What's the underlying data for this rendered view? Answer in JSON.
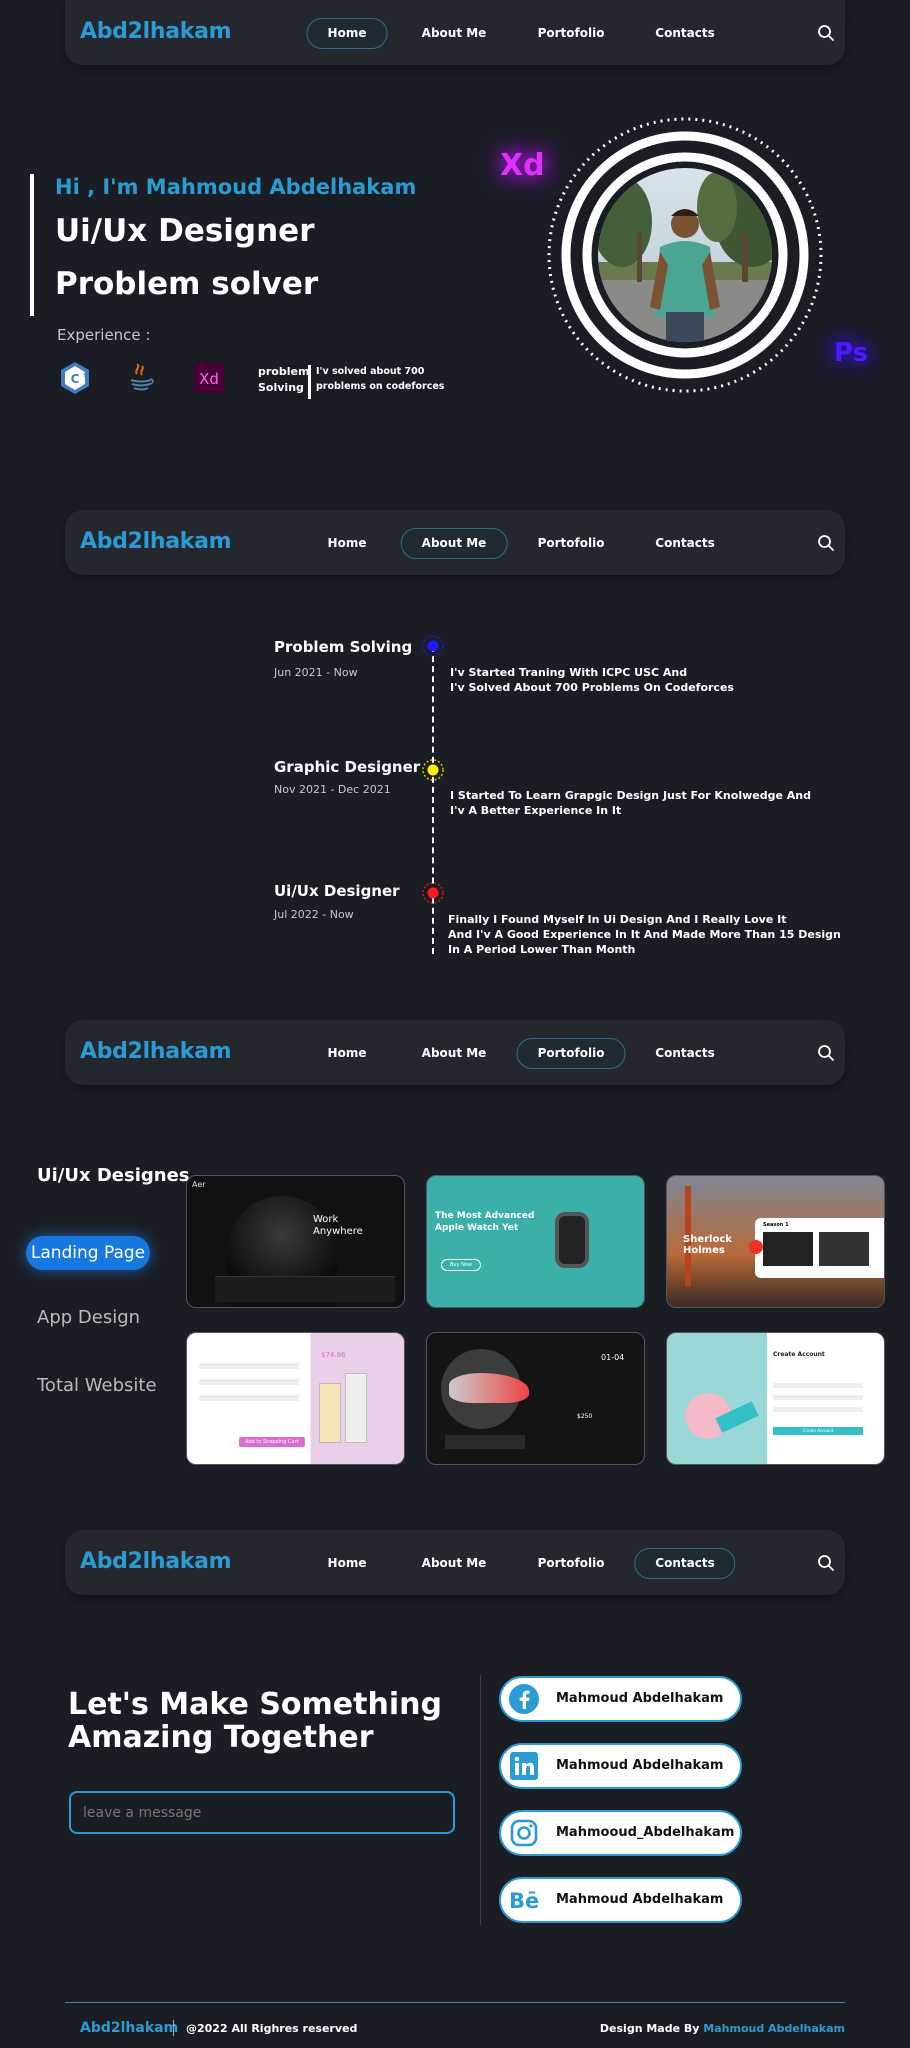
{
  "brand": "Abd2lhakam",
  "nav_items": [
    "Home",
    "About Me",
    "Portofolio",
    "Contacts"
  ],
  "navbars": [
    {
      "active": "Home"
    },
    {
      "active": "About Me"
    },
    {
      "active": "Portofolio"
    },
    {
      "active": "Contacts"
    }
  ],
  "hero": {
    "greeting": "Hi , I'm Mahmoud Abdelhakam",
    "role1": "Ui/Ux Designer",
    "role2": "Problem solver",
    "experience_label": "Experience :",
    "skills": [
      "c++-icon",
      "java-icon",
      "adobe-xd-icon"
    ],
    "xd_badge": "Xd",
    "problem_label_1": "problem",
    "problem_label_2": "Solving",
    "problem_note_1": "I'v solved about 700",
    "problem_note_2": "problems on codeforces",
    "glow_xd": "Xd",
    "glow_ps": "Ps"
  },
  "timeline": [
    {
      "title": "Problem Solving",
      "date": "Jun 2021 - Now",
      "desc": [
        "I'v Started Traning With ICPC USC And",
        "I'v Solved About 700 Problems On Codeforces"
      ],
      "dot_color": "#1a1aff"
    },
    {
      "title": "Graphic Designer",
      "date": "Nov 2021 - Dec 2021",
      "desc": [
        "I Started To Learn Grapgic Design Just For Knolwedge And",
        "I'v A Better Experience In It"
      ],
      "dot_color": "#ffee00"
    },
    {
      "title": "Ui/Ux Designer",
      "date": "Jul 2022 - Now",
      "desc": [
        "Finally I Found Myself In Ui Design And I Really Love It",
        "And I'v A Good Experience In It And Made More Than 15 Design",
        "In A Period Lower Than Month"
      ],
      "dot_color": "#ff1a1a"
    }
  ],
  "portfolio": {
    "heading": "Ui/Ux Designes",
    "categories": [
      "Landing Page",
      "App Design",
      "Total Website"
    ],
    "active": "Landing Page",
    "cards": [
      {
        "text1": "Work",
        "text2": "Anywhere",
        "label": "Aer"
      },
      {
        "text1": "The Most Advanced",
        "text2": "Apple Watch Yet",
        "label": "Buy Now"
      },
      {
        "text1": "Sherlock",
        "text2": "Holmes",
        "label": "Season 1"
      },
      {
        "text1": "$74.86",
        "text2": "",
        "label": "Add to Shopping Cart"
      },
      {
        "text1": "01",
        "text2": "04",
        "label": "$250"
      },
      {
        "text1": "Create Account",
        "text2": "",
        "label": "Create Account"
      }
    ]
  },
  "contact": {
    "heading_1": "Let's Make Something",
    "heading_2": "Amazing Together",
    "message_placeholder": "leave a message",
    "socials": [
      {
        "icon": "facebook-icon",
        "label": "Mahmoud Abdelhakam"
      },
      {
        "icon": "linkedin-icon",
        "label": "Mahmoud Abdelhakam"
      },
      {
        "icon": "instagram-icon",
        "label": "Mahmooud_Abdelhakam"
      },
      {
        "icon": "behance-icon",
        "label": "Mahmoud Abdelhakam"
      }
    ]
  },
  "footer": {
    "brand": "Abd2lhakam",
    "copyright": "@2022 All Righres reserved",
    "credit_prefix": "Design Made By ",
    "credit_name": "Mahmoud Abdelhakam"
  },
  "colors": {
    "accent": "#2b9bd3",
    "background": "#1a1e24",
    "nav": "#24282e",
    "active_pill": "#1778e0"
  }
}
